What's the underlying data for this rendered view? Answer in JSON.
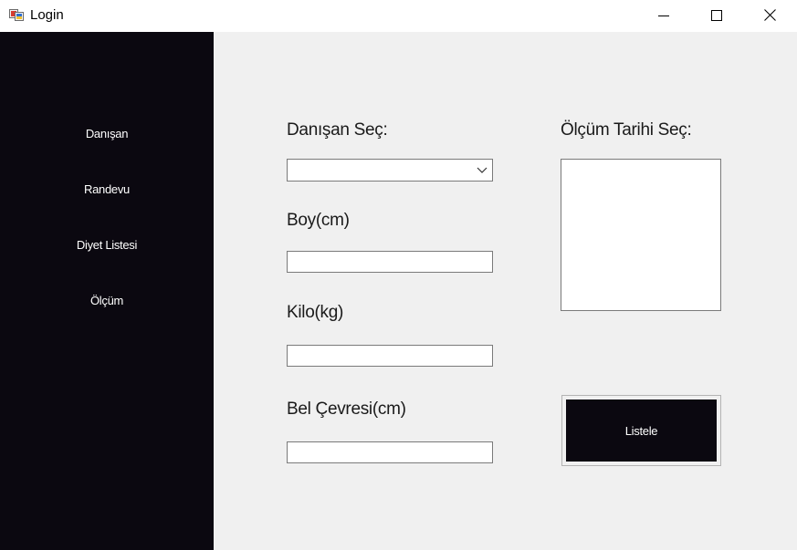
{
  "window": {
    "title": "Login"
  },
  "sidebar": {
    "items": [
      {
        "label": "Danışan"
      },
      {
        "label": "Randevu"
      },
      {
        "label": "Diyet Listesi"
      },
      {
        "label": "Ölçüm"
      }
    ]
  },
  "form": {
    "client_select_label": "Danışan Seç:",
    "client_select_value": "",
    "height_label": "Boy(cm)",
    "height_value": "",
    "weight_label": "Kilo(kg)",
    "weight_value": "",
    "waist_label": "Bel Çevresi(cm)",
    "waist_value": "",
    "date_select_label": "Ölçüm Tarihi Seç:",
    "list_button_label": "Listele"
  },
  "colors": {
    "sidebar_bg": "#0b0810",
    "main_bg": "#f0f0f0",
    "button_bg": "#0b0810",
    "text_light": "#ffffff"
  }
}
